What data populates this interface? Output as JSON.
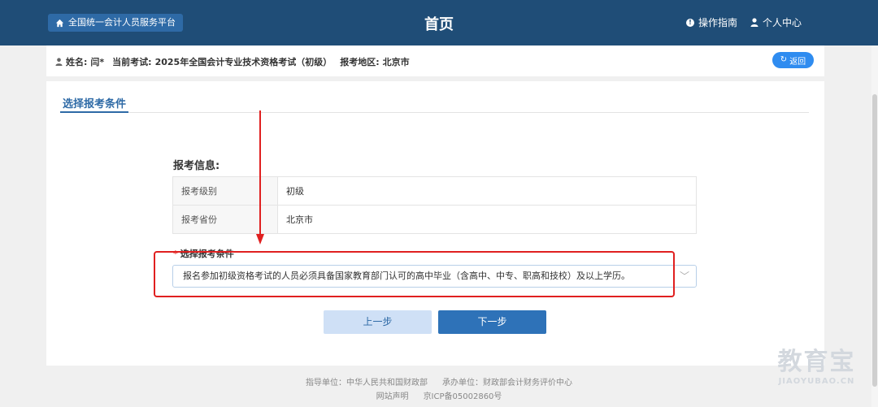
{
  "header": {
    "platform_button": "全国统一会计人员服务平台",
    "title": "首页",
    "guide_link": "操作指南",
    "user_center_link": "个人中心"
  },
  "infobar": {
    "name_label": "姓名:",
    "name_value": "闫*",
    "exam_label": "当前考试:",
    "exam_value": "2025年全国会计专业技术资格考试（初级）",
    "region_label": "报考地区:",
    "region_value": "北京市",
    "back_button": "返回"
  },
  "tab": {
    "active": "选择报考条件"
  },
  "form": {
    "section_title": "报考信息:",
    "rows": [
      {
        "key": "报考级别",
        "value": "初级"
      },
      {
        "key": "报考省份",
        "value": "北京市"
      }
    ],
    "condition_required": "*",
    "condition_label": "选择报考条件",
    "condition_value": "报名参加初级资格考试的人员必须具备国家教育部门认可的高中毕业（含高中、中专、职高和技校）及以上学历。",
    "prev_button": "上一步",
    "next_button": "下一步"
  },
  "footer": {
    "guide_unit": "指导单位：中华人民共和国财政部",
    "host_unit": "承办单位：财政部会计财务评价中心",
    "statement": "网站声明",
    "icp": "京ICP备05002860号"
  },
  "watermark": {
    "cn": "教育宝",
    "en": "JIAOYUBAO.CN"
  },
  "colors": {
    "header_bg": "#1f4d77",
    "accent": "#2e6aa6",
    "back_button": "#2f8cf0",
    "annotation": "#e02020"
  },
  "icons": [
    "home-icon",
    "info-icon",
    "person-icon",
    "refresh-icon",
    "chevron-down-icon",
    "arrow-down-icon"
  ]
}
